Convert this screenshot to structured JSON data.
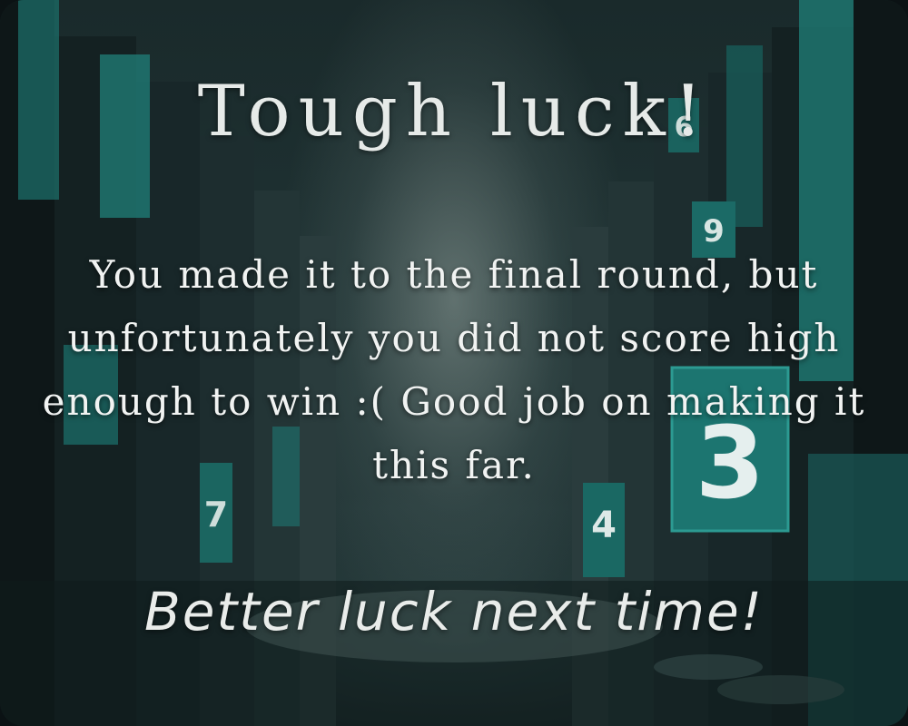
{
  "screen": {
    "title": "Tough luck!",
    "message": "You made it to the final round, but unfortunately you did not score high enough to win :( Good job on making it this far.",
    "closing": "Better luck next time!"
  },
  "scene": {
    "signs": [
      {
        "digit": "9",
        "icon": "number-sign-icon"
      },
      {
        "digit": "3",
        "icon": "number-sign-icon"
      },
      {
        "digit": "4",
        "icon": "number-sign-icon"
      },
      {
        "digit": "7",
        "icon": "number-sign-icon"
      },
      {
        "digit": "6",
        "icon": "number-sign-icon"
      }
    ]
  },
  "colors": {
    "accent": "#1e8a83",
    "text": "#f1f3f2",
    "fog": "#9aa8a5"
  }
}
